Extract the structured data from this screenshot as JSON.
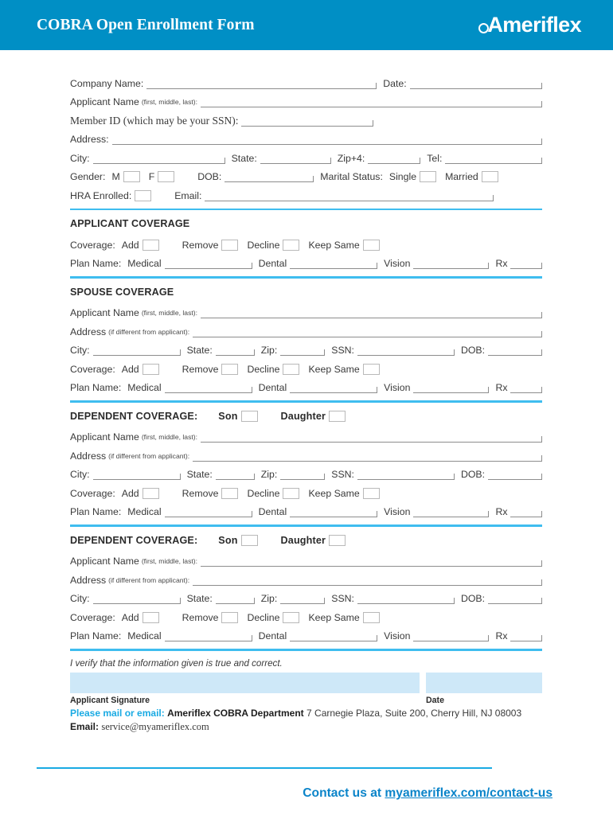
{
  "header": {
    "title": "COBRA Open Enrollment Form",
    "logo_text": "Ameriflex",
    "logo_mark": "circle-loop-icon",
    "bg_color": "#008fc5"
  },
  "colors": {
    "header_blue": "#008fc5",
    "divider_blue": "#3fbdef",
    "signature_box": "#cee8f8",
    "link_blue": "#0b84c9",
    "accent_cyan": "#19aae3"
  },
  "applicant_info": {
    "company_name_label": "Company Name:",
    "date_label": "Date:",
    "applicant_name_label": "Applicant Name",
    "applicant_name_sub": "(first, middle, last):",
    "member_id_label": "Member ID (which may be your SSN):",
    "address_label": "Address:",
    "city_label": "City:",
    "state_label": "State:",
    "zip_label": "Zip+4:",
    "tel_label": "Tel:",
    "gender_label": "Gender:",
    "gender_male": "M",
    "gender_female": "F",
    "dob_label": "DOB:",
    "marital_label": "Marital Status:",
    "marital_single": "Single",
    "marital_married": "Married",
    "hra_label": "HRA Enrolled:",
    "email_label": "Email:"
  },
  "coverage_labels": {
    "coverage": "Coverage:",
    "add": "Add",
    "remove": "Remove",
    "decline": "Decline",
    "keep_same": "Keep Same",
    "plan_name": "Plan Name:",
    "medical": "Medical",
    "dental": "Dental",
    "vision": "Vision",
    "rx": "Rx"
  },
  "shared_labels": {
    "applicant_name": "Applicant Name",
    "applicant_name_sub": "(first, middle, last):",
    "address": "Address",
    "address_sub": "(if different from applicant):",
    "city": "City:",
    "state": "State:",
    "zip": "Zip:",
    "ssn": "SSN:",
    "dob": "DOB:"
  },
  "sections": {
    "applicant_coverage_title": "APPLICANT COVERAGE",
    "spouse_coverage_title": "SPOUSE COVERAGE",
    "dependent_coverage_title": "DEPENDENT COVERAGE:",
    "dependent_son": "Son",
    "dependent_daughter": "Daughter"
  },
  "signature": {
    "verify_text": "I verify that the information given is true and correct.",
    "applicant_signature_label": "Applicant Signature",
    "date_label": "Date",
    "mail_prefix": "Please mail or email:",
    "mail_department": "Ameriflex COBRA Department",
    "mail_address": "7 Carnegie Plaza, Suite 200, Cherry Hill, NJ 08003",
    "email_label": "Email:",
    "email_value": "service@myameriflex.com"
  },
  "footer": {
    "contact_prefix": "Contact us at ",
    "contact_link": "myameriflex.com/contact-us"
  }
}
